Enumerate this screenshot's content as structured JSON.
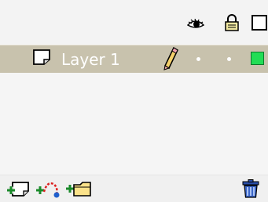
{
  "layer_panel": {
    "header": {
      "eye_icon": "eye-icon",
      "lock_icon": "lock-icon",
      "outline_icon": "outline-square-icon"
    },
    "layers": [
      {
        "name": "Layer 1",
        "icon": "page-icon",
        "status_icon": "pencil-icon",
        "visible": true,
        "locked": false,
        "outline_color": "#22dd55",
        "selected": true
      }
    ],
    "footer": {
      "add_layer_icon": "add-layer-icon",
      "add_guide_icon": "add-motion-guide-icon",
      "add_folder_icon": "add-folder-icon",
      "delete_icon": "trash-icon"
    }
  },
  "colors": {
    "selected_row": "#c8c2ad",
    "panel_bg": "#f5f5f5",
    "outline_green": "#22dd55"
  }
}
